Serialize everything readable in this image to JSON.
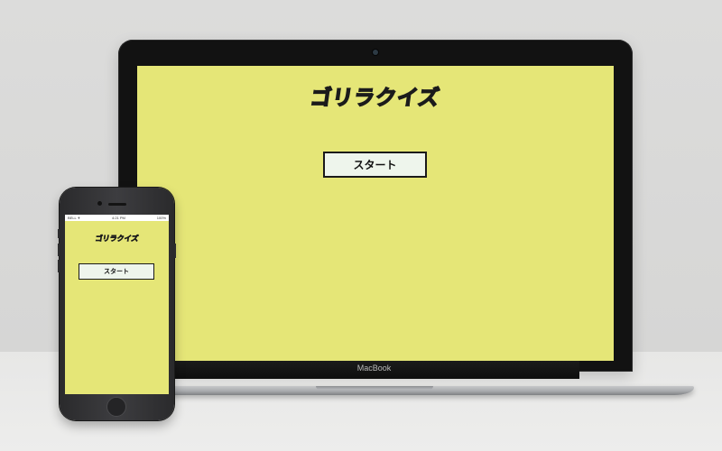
{
  "laptop": {
    "brand": "MacBook",
    "app": {
      "title": "ゴリラクイズ",
      "start_label": "スタート"
    }
  },
  "phone": {
    "status": {
      "carrier": "BELL ✈",
      "time": "4:21 PM",
      "battery": "100%"
    },
    "app": {
      "title": "ゴリラクイズ",
      "start_label": "スタート"
    }
  },
  "colors": {
    "screen_background": "#e5e677",
    "button_background": "#eef5ec",
    "button_border": "#1a1a1a",
    "title_fill": "#ffffff",
    "title_outline": "#1b1b1b"
  }
}
